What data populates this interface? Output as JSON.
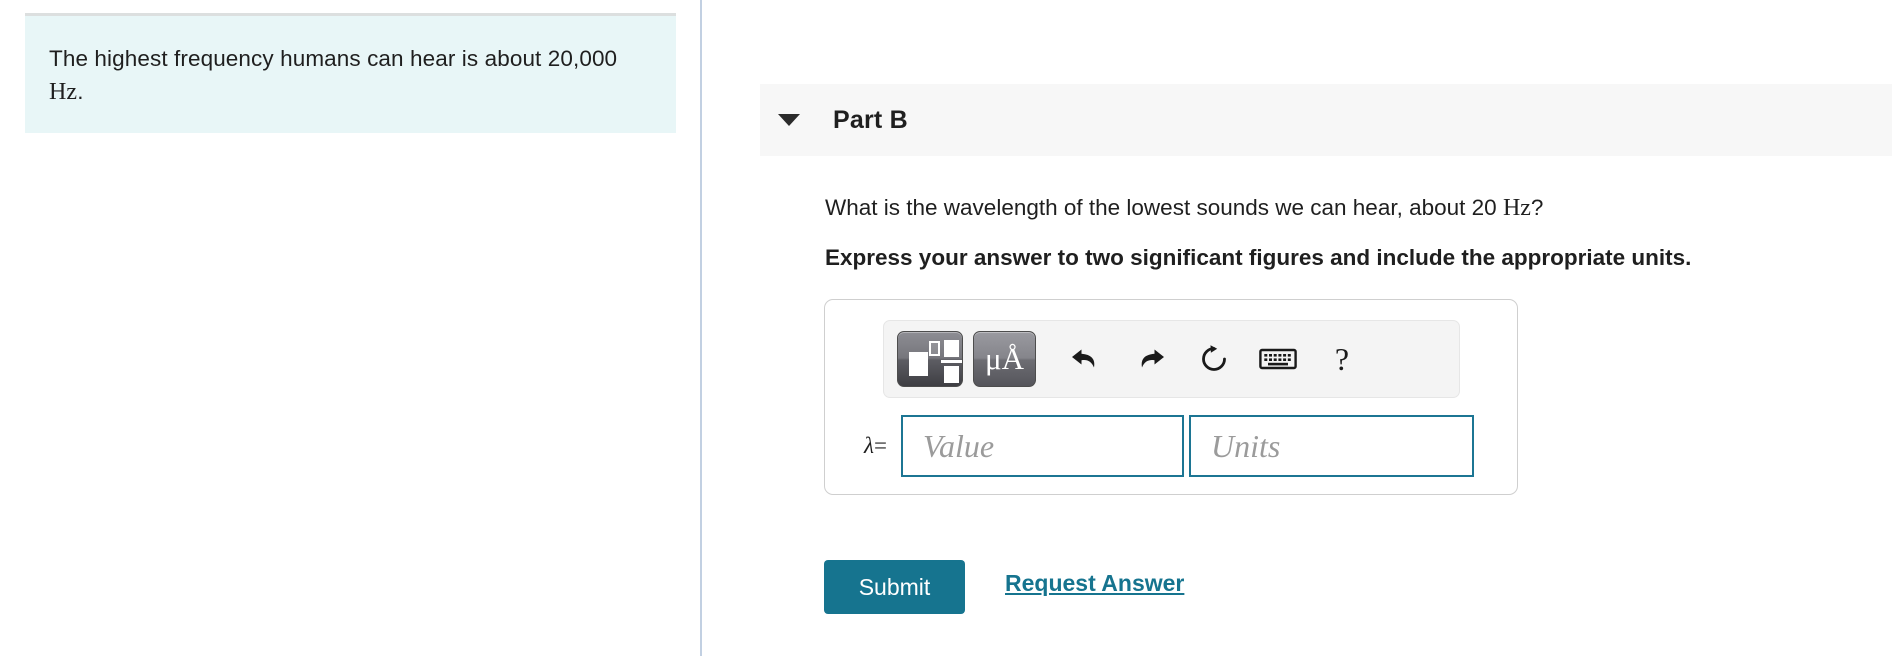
{
  "left_panel": {
    "hint": {
      "text_before": "The highest frequency humans can hear is about 20,000 ",
      "unit": "Hz",
      "text_after": ".",
      "background_color": "#e8f6f7"
    }
  },
  "right_panel": {
    "part": {
      "title": "Part B",
      "caret_icon": "chevron-down-icon",
      "header_background": "#f7f7f7",
      "expanded": true
    },
    "question": {
      "text_before": "What is the wavelength of the lowest sounds we can hear, about 20 ",
      "unit": "Hz",
      "text_after": "?"
    },
    "instruction": "Express your answer to two significant figures and include the appropriate units.",
    "answer_box": {
      "toolbar": {
        "buttons": [
          {
            "name": "math-template-button",
            "label": "",
            "title": "Math templates"
          },
          {
            "name": "greek-symbols-button",
            "label": "μÅ",
            "title": "Greek letters and symbols"
          },
          {
            "name": "undo-button",
            "label": "",
            "title": "Undo"
          },
          {
            "name": "redo-button",
            "label": "",
            "title": "Redo"
          },
          {
            "name": "reset-button",
            "label": "",
            "title": "Reset"
          },
          {
            "name": "keyboard-button",
            "label": "",
            "title": "Keyboard shortcuts"
          },
          {
            "name": "help-button",
            "label": "?",
            "title": "Help"
          }
        ]
      },
      "variable_label": "λ",
      "equals_sign": "=",
      "value_placeholder": "Value",
      "units_placeholder": "Units",
      "value": "",
      "units": "",
      "border_color": "#1c7593"
    },
    "actions": {
      "submit_label": "Submit",
      "request_answer_label": "Request Answer",
      "accent_color": "#16748f"
    }
  }
}
